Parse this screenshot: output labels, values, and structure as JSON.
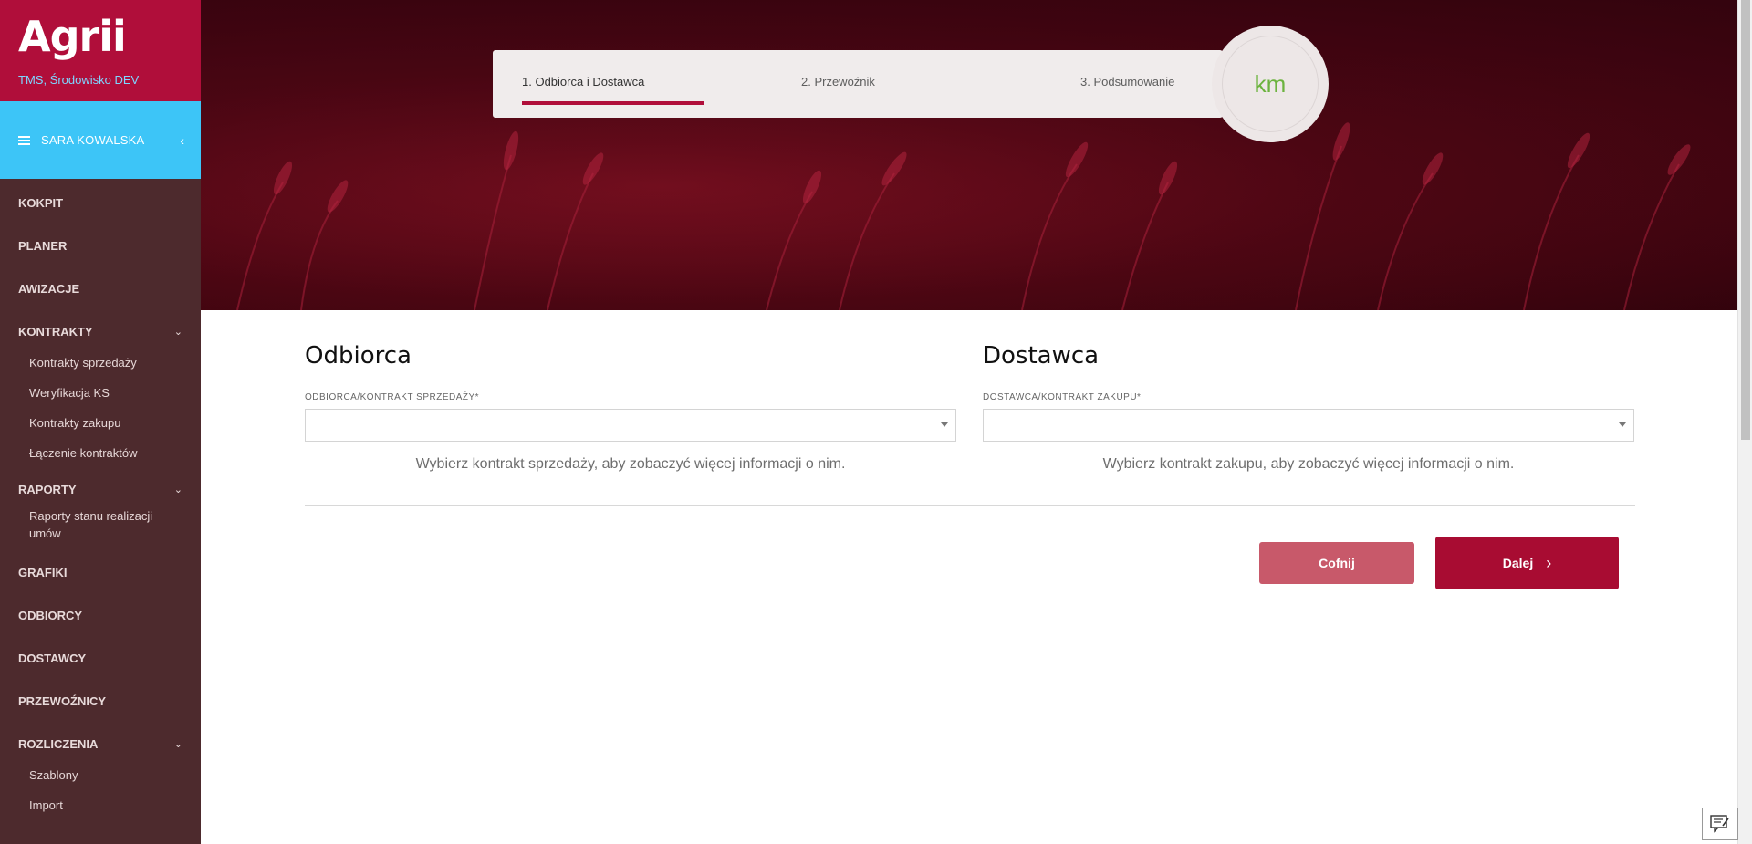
{
  "brand": {
    "logo": "Agrii",
    "environment": "TMS, Środowisko DEV"
  },
  "user": {
    "name": "SARA KOWALSKA",
    "collapse_glyph": "‹"
  },
  "sidebar": {
    "items": [
      {
        "label": "KOKPIT"
      },
      {
        "label": "PLANER"
      },
      {
        "label": "AWIZACJE"
      },
      {
        "label": "KONTRAKTY",
        "expanded": true,
        "children": [
          "Kontrakty sprzedaży",
          "Weryfikacja KS",
          "Kontrakty zakupu",
          "Łączenie kontraktów"
        ]
      },
      {
        "label": "RAPORTY",
        "expanded": true,
        "children": [
          "Raporty stanu realizacji umów"
        ]
      },
      {
        "label": "GRAFIKI"
      },
      {
        "label": "ODBIORCY"
      },
      {
        "label": "DOSTAWCY"
      },
      {
        "label": "PRZEWOŹNICY"
      },
      {
        "label": "ROZLICZENIA",
        "expanded": true,
        "children": [
          "Szablony",
          "Import"
        ]
      }
    ],
    "chevron_glyph": "⌄"
  },
  "stepper": {
    "steps": [
      "1. Odbiorca i Dostawca",
      "2. Przewoźnik",
      "3. Podsumowanie"
    ],
    "active_step": 1,
    "distance_unit": "km"
  },
  "form": {
    "recipient": {
      "title": "Odbiorca",
      "field_label": "ODBIORCA/KONTRAKT SPRZEDAŻY*",
      "value": "",
      "hint": "Wybierz kontrakt sprzedaży, aby zobaczyć więcej informacji o nim."
    },
    "supplier": {
      "title": "Dostawca",
      "field_label": "DOSTAWCA/KONTRAKT ZAKUPU*",
      "value": "",
      "hint": "Wybierz kontrakt zakupu, aby zobaczyć więcej informacji o nim."
    },
    "buttons": {
      "back": "Cofnij",
      "next": "Dalej",
      "next_arrow": "›"
    }
  },
  "colors": {
    "brand": "#b00e3a",
    "userbar": "#3dc5f7",
    "sidebar": "#4d2a2d",
    "accent_green": "#6cb33f"
  }
}
